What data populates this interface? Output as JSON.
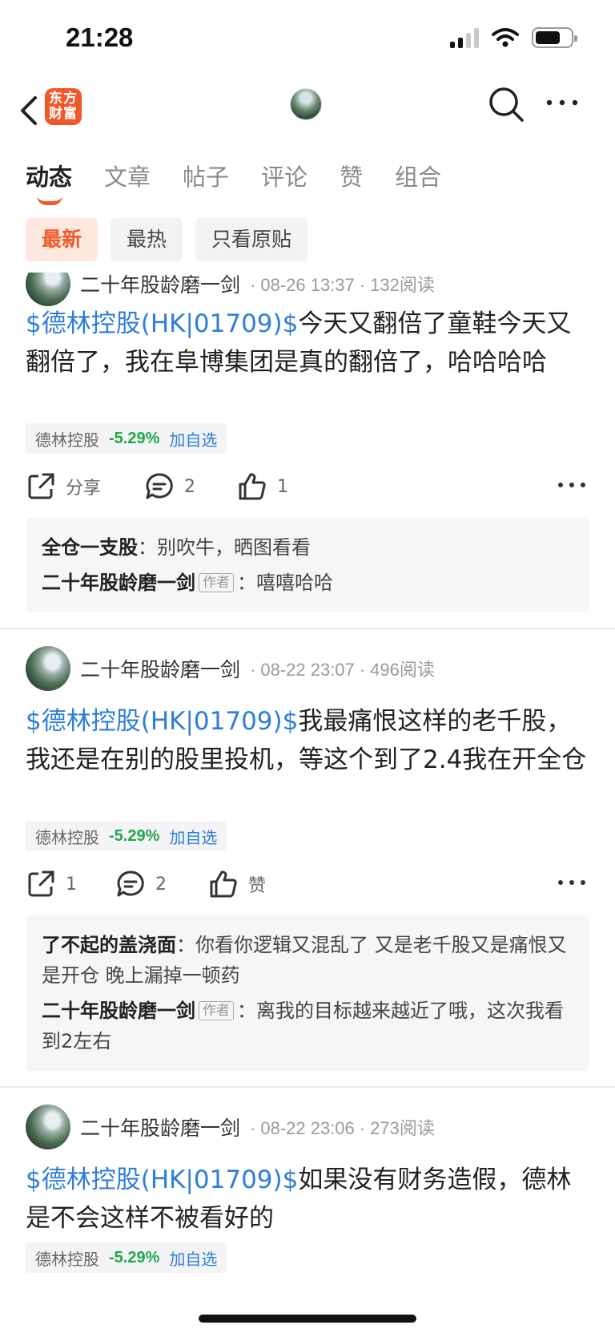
{
  "status": {
    "time": "21:28"
  },
  "nav": {
    "logo_line1": "东方",
    "logo_line2": "财富"
  },
  "tabs": [
    "动态",
    "文章",
    "帖子",
    "评论",
    "赞",
    "组合"
  ],
  "filters": [
    "最新",
    "最热",
    "只看原贴"
  ],
  "posts": [
    {
      "author": "二十年股龄磨一剑",
      "date": "08-26 13:37",
      "reads": "132阅读",
      "stock_link": "$德林控股(HK|01709)$",
      "text": "今天又翻倍了童鞋今天又翻倍了，我在阜博集团是真的翻倍了，哈哈哈哈",
      "tag": {
        "name": "德林控股",
        "change": "-5.29%",
        "add": "加自选"
      },
      "share": "分享",
      "comment_count": "2",
      "like_count": "1",
      "comments": [
        {
          "who": "全仓一支股",
          "author_badge": "",
          "text": "别吹牛，晒图看看"
        },
        {
          "who": "二十年股龄磨一剑",
          "author_badge": "作者",
          "text": "嘻嘻哈哈"
        }
      ]
    },
    {
      "author": "二十年股龄磨一剑",
      "date": "08-22 23:07",
      "reads": "496阅读",
      "stock_link": "$德林控股(HK|01709)$",
      "text": "我最痛恨这样的老千股，我还是在别的股里投机，等这个到了2.4我在开全仓",
      "tag": {
        "name": "德林控股",
        "change": "-5.29%",
        "add": "加自选"
      },
      "share": "1",
      "comment_count": "2",
      "like_count": "赞",
      "comments": [
        {
          "who": "了不起的盖浇面",
          "author_badge": "",
          "text": "你看你逻辑又混乱了  又是老千股又是痛恨又是开仓  晚上漏掉一顿药"
        },
        {
          "who": "二十年股龄磨一剑",
          "author_badge": "作者",
          "text": "离我的目标越来越近了哦，这次我看到2左右"
        }
      ]
    },
    {
      "author": "二十年股龄磨一剑",
      "date": "08-22 23:06",
      "reads": "273阅读",
      "stock_link": "$德林控股(HK|01709)$",
      "text": "如果没有财务造假，德林是不会这样不被看好的",
      "tag": {
        "name": "德林控股",
        "change": "-5.29%",
        "add": "加自选"
      }
    }
  ]
}
